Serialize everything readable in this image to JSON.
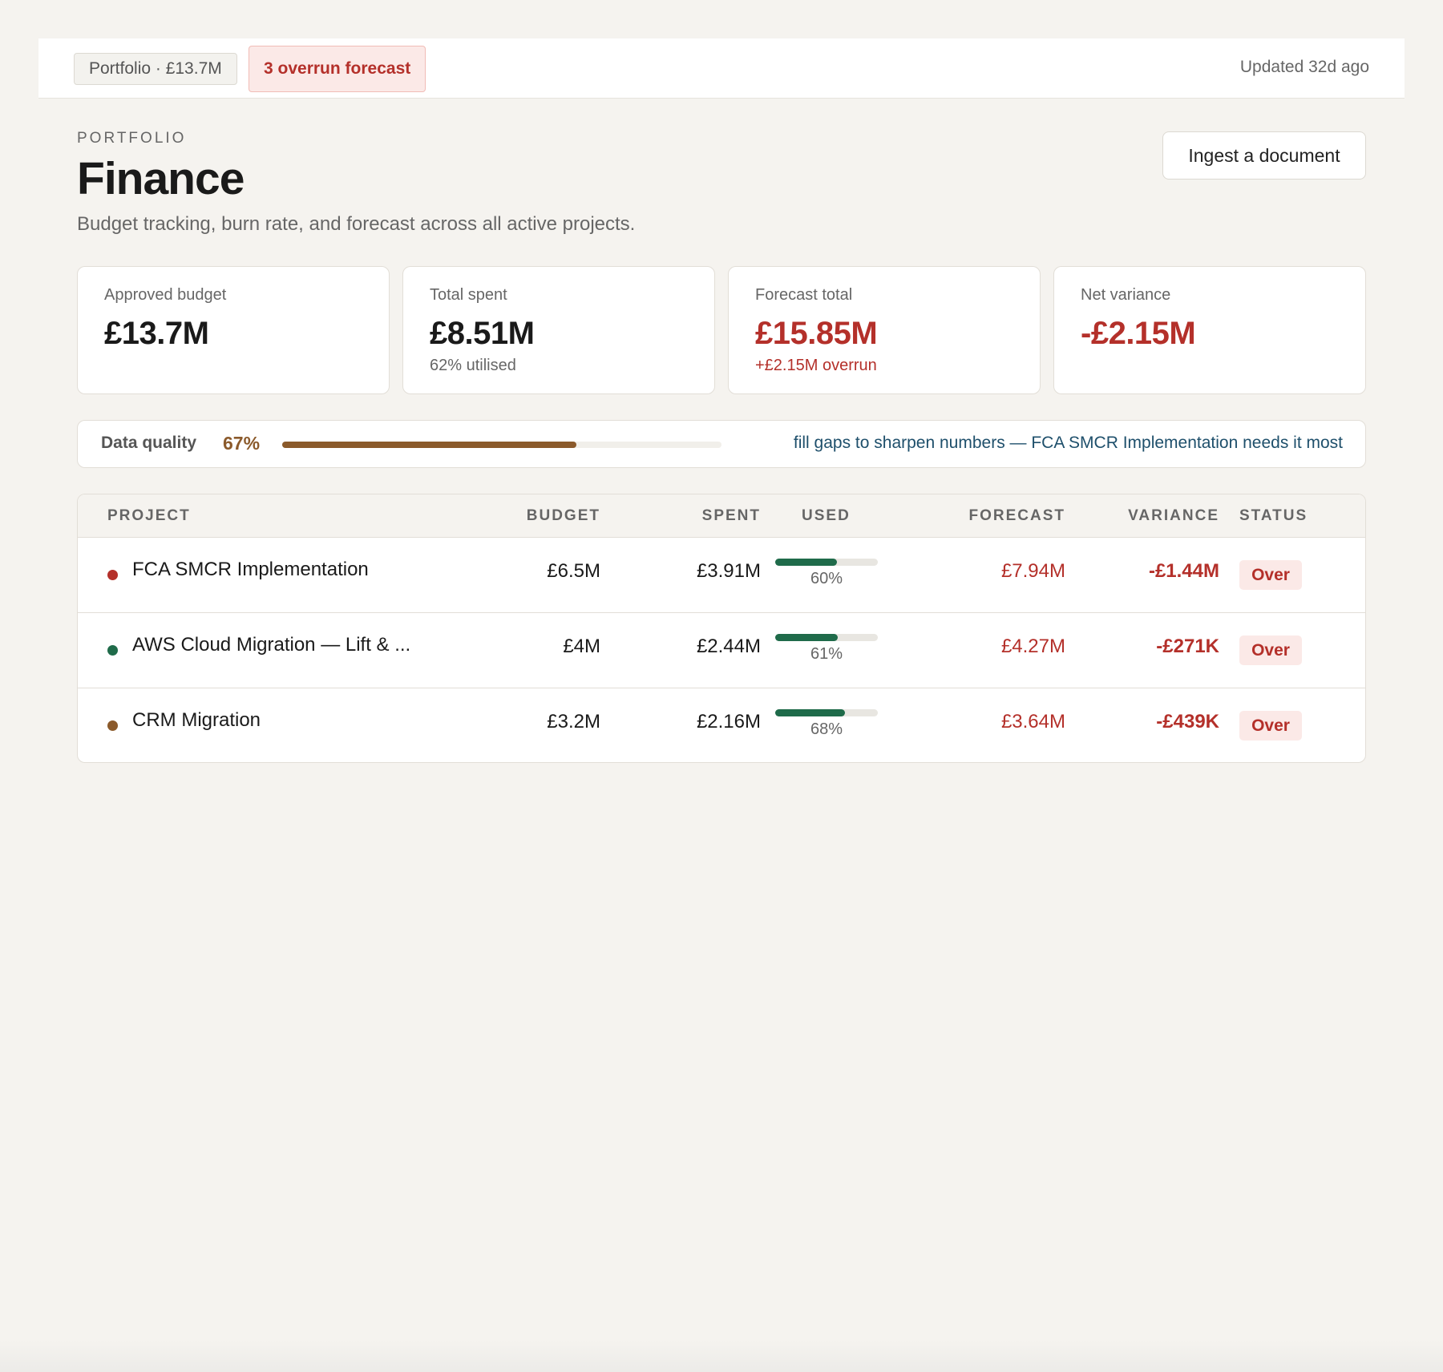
{
  "topbar": {
    "portfolio_chip": "Portfolio · £13.7M",
    "overrun_chip": "3 overrun forecast",
    "updated": "Updated 32d ago"
  },
  "header": {
    "eyebrow": "PORTFOLIO",
    "title": "Finance",
    "subtitle": "Budget tracking, burn rate, and forecast across all active projects.",
    "ingest_button": "Ingest a document"
  },
  "kpis": [
    {
      "label": "Approved budget",
      "value": "£13.7M",
      "sub": ""
    },
    {
      "label": "Total spent",
      "value": "£8.51M",
      "sub": "62% utilised"
    },
    {
      "label": "Forecast total",
      "value": "£15.85M",
      "sub": "+£2.15M overrun"
    },
    {
      "label": "Net variance",
      "value": "-£2.15M",
      "sub": ""
    }
  ],
  "data_quality": {
    "label": "Data quality",
    "percent_text": "67%",
    "percent": 67,
    "hint": "fill gaps to sharpen numbers — FCA SMCR Implementation needs it most"
  },
  "table": {
    "headers": {
      "project": "PROJECT",
      "budget": "BUDGET",
      "spent": "SPENT",
      "used": "USED",
      "forecast": "FORECAST",
      "variance": "VARIANCE",
      "status": "STATUS"
    },
    "rows": [
      {
        "name": "FCA SMCR Implementation",
        "dot_color": "#b4302a",
        "budget": "£6.5M",
        "spent": "£3.91M",
        "used_text": "60%",
        "used": 60,
        "forecast": "£7.94M",
        "variance": "-£1.44M",
        "status": "Over"
      },
      {
        "name": "AWS Cloud Migration — Lift & ...",
        "dot_color": "#1f6b4a",
        "budget": "£4M",
        "spent": "£2.44M",
        "used_text": "61%",
        "used": 61,
        "forecast": "£4.27M",
        "variance": "-£271K",
        "status": "Over"
      },
      {
        "name": "CRM Migration",
        "dot_color": "#8b5a2b",
        "budget": "£3.2M",
        "spent": "£2.16M",
        "used_text": "68%",
        "used": 68,
        "forecast": "£3.64M",
        "variance": "-£439K",
        "status": "Over"
      }
    ]
  },
  "colors": {
    "danger": "#b4302a",
    "success": "#1f6b4a",
    "quality": "#8b5a2b",
    "link": "#1e4f6b"
  }
}
